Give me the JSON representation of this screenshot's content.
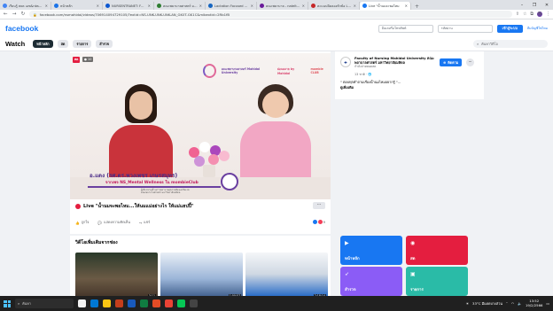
{
  "browser": {
    "tabs": [
      {
        "title": "เรียนรู้ สธค เอช&nbsp;ไอวี - ค้นหาด้วย",
        "favicon_color": "#4285f4"
      },
      {
        "title": "หน้าหลัก",
        "favicon_color": "#1a73e8"
      },
      {
        "title": "NURSENTRANET: Faculty",
        "favicon_color": "#0b57d0"
      },
      {
        "title": "คณะพยาบาลศาสตร์ ม.มหิดล",
        "favicon_color": "#2e7d32"
      },
      {
        "title": "Lactation Focused discussi",
        "favicon_color": "#1565c0"
      },
      {
        "title": "คณะพยาบาล - nateltd.com",
        "favicon_color": "#6a1b9a"
      },
      {
        "title": "คะแนนปิดลองหัวข้อ Live",
        "favicon_color": "#c62828"
      },
      {
        "title": "Live \"น้ำนมจะพอไหม",
        "favicon_color": "#1877f2",
        "active": true
      }
    ],
    "new_tab": "+",
    "window_controls": [
      "–",
      "❐",
      "✕"
    ],
    "nav": {
      "back": "←",
      "forward": "→",
      "reload": "↻"
    },
    "url": "facebook.com/nsmahidol/videos/706914094729105/?extid=NS-UNK-UNK-UNK-AN_GK0T-GK1C&mibextid=2Rb1fB",
    "profile_initial": "N"
  },
  "fb": {
    "logo": "facebook",
    "email_placeholder": "อีเมลหรือโทรศัพท์",
    "password_placeholder": "รหัสผ่าน",
    "login_label": "เข้าสู่ระบบ",
    "forgot_label": "ลืมบัญชีใช่ไหม",
    "watch_title": "Watch",
    "watch_tabs": [
      "หน้าหลัก",
      "สด",
      "รายการ",
      "สำรวจ"
    ],
    "search_placeholder": "ค้นหาวิดีโอ"
  },
  "video": {
    "live_badge": "สด",
    "views": "● 10",
    "logo_mahidol": "คณะพยาบาลศาสตร์ Mahidol University",
    "logo_nsmental": "ผ่อนคลาย by Mahidol",
    "logo_mombie": "mombie CLUB",
    "lt_name": "อ.แดง (รศ.ดร.พวงเพชร เกษรสมุทร)",
    "lt_sub": "จากเพจ NS_Mental Wellness ใน mombieClub",
    "lt_small1": "ผู้เชี่ยวชาญด้านการพยาบาลสุขภาพจิตและจิตเวช",
    "lt_small2": "คณะพยาบาลศาสตร์ มหาวิทยาลัยมหิดล",
    "title": "Live \"น้ำนมจะพอไหม...ให้นมแม่อย่างไร ให้แม่แฮปปี้\"",
    "more": "···",
    "like": "ถูกใจ",
    "comment": "แสดงความคิดเห็น",
    "share": "แชร์",
    "reactions_count": "9"
  },
  "page": {
    "name": "Faculty of Nursing Mahidol University คณะพยาบาลศาสตร์ มหาวิทยาลัยมหิดล",
    "verified_subtitle": "กำลังถ่ายทอดสด",
    "time": "13 ชาติ · 🌐",
    "follow_label": "ติดตาม",
    "quote": "\" ตอบทุกคำถามเรื่องน้ำนมไหมอยากรู้ \"...",
    "see_more": "ดูเพิ่มเติม"
  },
  "more_videos": {
    "title": "วิดีโอเพิ่มเติมจากช่อง",
    "items": [
      {
        "duration": "3:11"
      },
      {
        "duration": "1:00:57"
      },
      {
        "duration": "2:18:14"
      }
    ]
  },
  "categories": [
    {
      "label": "หน้าหลัก",
      "icon": "play-icon",
      "color": "#1877f2"
    },
    {
      "label": "สด",
      "icon": "live-icon",
      "color": "#e41e3f"
    },
    {
      "label": "สำรวจ",
      "icon": "rocket-icon",
      "color": "#8b5cf6"
    },
    {
      "label": "รายการ",
      "icon": "show-icon",
      "color": "#2abba7"
    }
  ],
  "taskbar": {
    "search_placeholder": "ค้นหา",
    "weather": "33°C มีแดดบางส่วน",
    "time": "13:52",
    "date": "19/2/2566"
  }
}
